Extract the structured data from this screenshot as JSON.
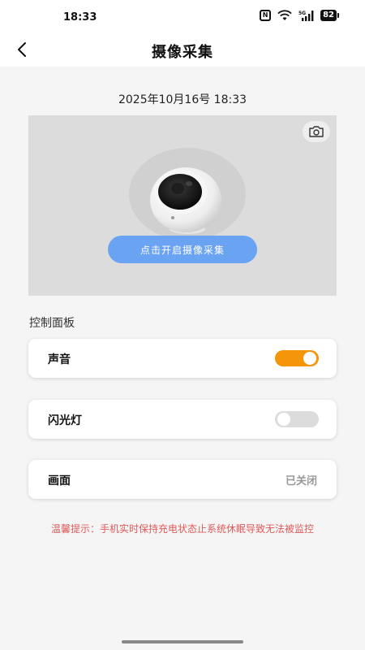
{
  "status_bar": {
    "time": "18:33",
    "nfc_label": "N",
    "battery_level": "82",
    "icons": [
      "nfc-icon",
      "wifi-icon",
      "signal-5g-icon",
      "battery-icon"
    ]
  },
  "nav": {
    "title": "摄像采集",
    "back_icon": "chevron-left-icon"
  },
  "datetime": "2025年10月16号 18:33",
  "camera": {
    "snapshot_icon": "camera-icon",
    "start_label": "点击开启摄像采集"
  },
  "control_panel": {
    "title": "控制面板",
    "items": [
      {
        "label": "声音",
        "type": "toggle",
        "on": true
      },
      {
        "label": "闪光灯",
        "type": "toggle",
        "on": false
      },
      {
        "label": "画面",
        "type": "status",
        "status": "已关闭"
      }
    ]
  },
  "tip": "温馨提示：手机实时保持充电状态止系统休眠导致无法被监控",
  "colors": {
    "accent_orange": "#f5950a",
    "button_blue": "#6ba3f3",
    "tip_red": "#e05a5a"
  }
}
